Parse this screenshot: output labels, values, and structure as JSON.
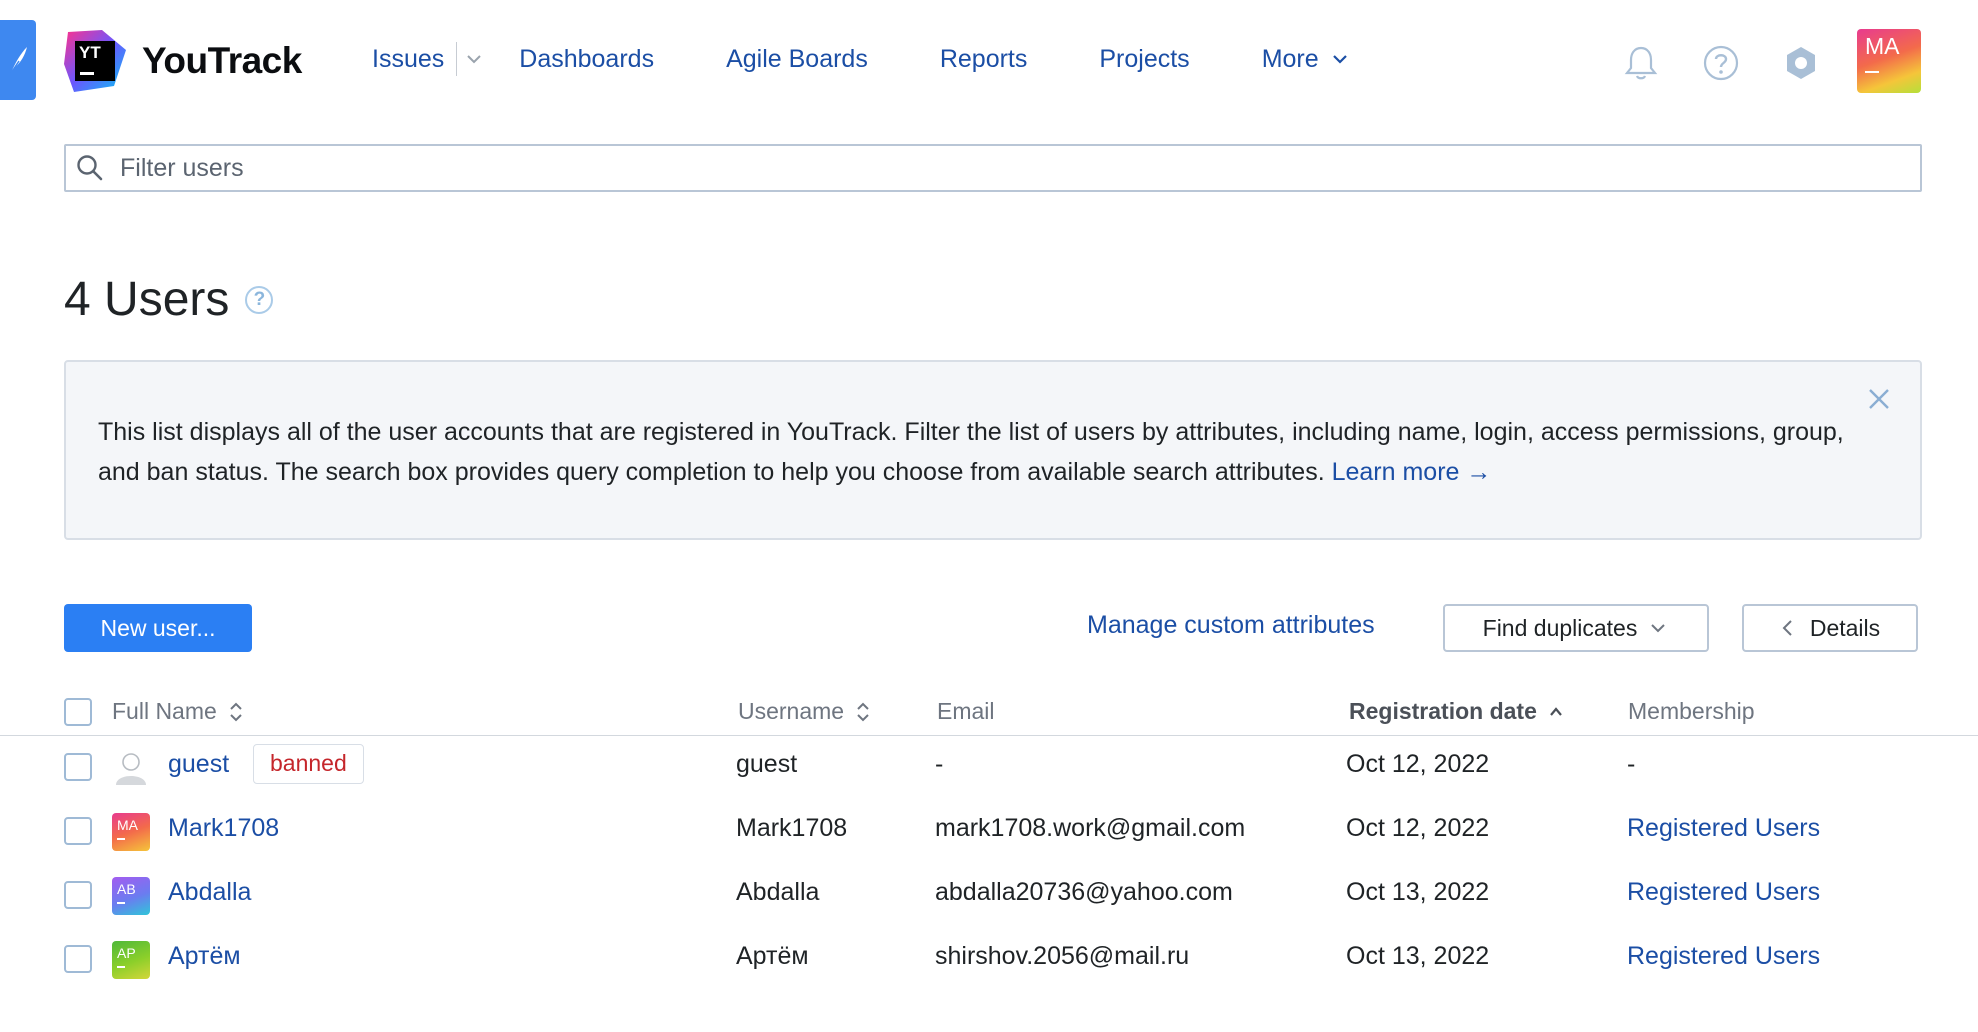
{
  "app": {
    "name": "YouTrack",
    "logo_letters": "YT"
  },
  "nav": {
    "items": [
      "Issues",
      "Dashboards",
      "Agile Boards",
      "Reports",
      "Projects",
      "More"
    ]
  },
  "header": {
    "avatar_initials": "MA"
  },
  "filter": {
    "placeholder": "Filter users",
    "value": ""
  },
  "page": {
    "title": "4 Users",
    "help_glyph": "?"
  },
  "info": {
    "text": "This list displays all of the user accounts that are registered in YouTrack. Filter the list of users by attributes, including name, login, access permissions, group, and ban status. The search box provides query completion to help you choose from available search attributes.",
    "link": "Learn more →"
  },
  "toolbar": {
    "new_user": "New user...",
    "manage_attrs": "Manage custom attributes",
    "find_duplicates": "Find duplicates",
    "details": "Details"
  },
  "table": {
    "columns": [
      "Full Name",
      "Username",
      "Email",
      "Registration date",
      "Membership"
    ],
    "rows": [
      {
        "full_name": "guest",
        "badge": "banned",
        "username": "guest",
        "email": "-",
        "date": "Oct 12, 2022",
        "membership": "-",
        "avatar": "",
        "avatar_bg": "#d5d8dc"
      },
      {
        "full_name": "Mark1708",
        "badge": "",
        "username": "Mark1708",
        "email": "mark1708.work@gmail.com",
        "date": "Oct 12, 2022",
        "membership": "Registered Users",
        "avatar": "MA",
        "avatar_bg": "#ef5e6a"
      },
      {
        "full_name": "Abdalla",
        "badge": "",
        "username": "Abdalla",
        "email": "abdalla20736@yahoo.com",
        "date": "Oct 13, 2022",
        "membership": "Registered Users",
        "avatar": "AB",
        "avatar_bg": "#8c6cf0"
      },
      {
        "full_name": "Артём",
        "badge": "",
        "username": "Артём",
        "email": "shirshov.2056@mail.ru",
        "date": "Oct 13, 2022",
        "membership": "Registered Users",
        "avatar": "AP",
        "avatar_bg": "#6fb62b"
      }
    ]
  },
  "colors": {
    "accent": "#2b7ff3",
    "link": "#1b4ea5",
    "banned": "#c5262b"
  }
}
